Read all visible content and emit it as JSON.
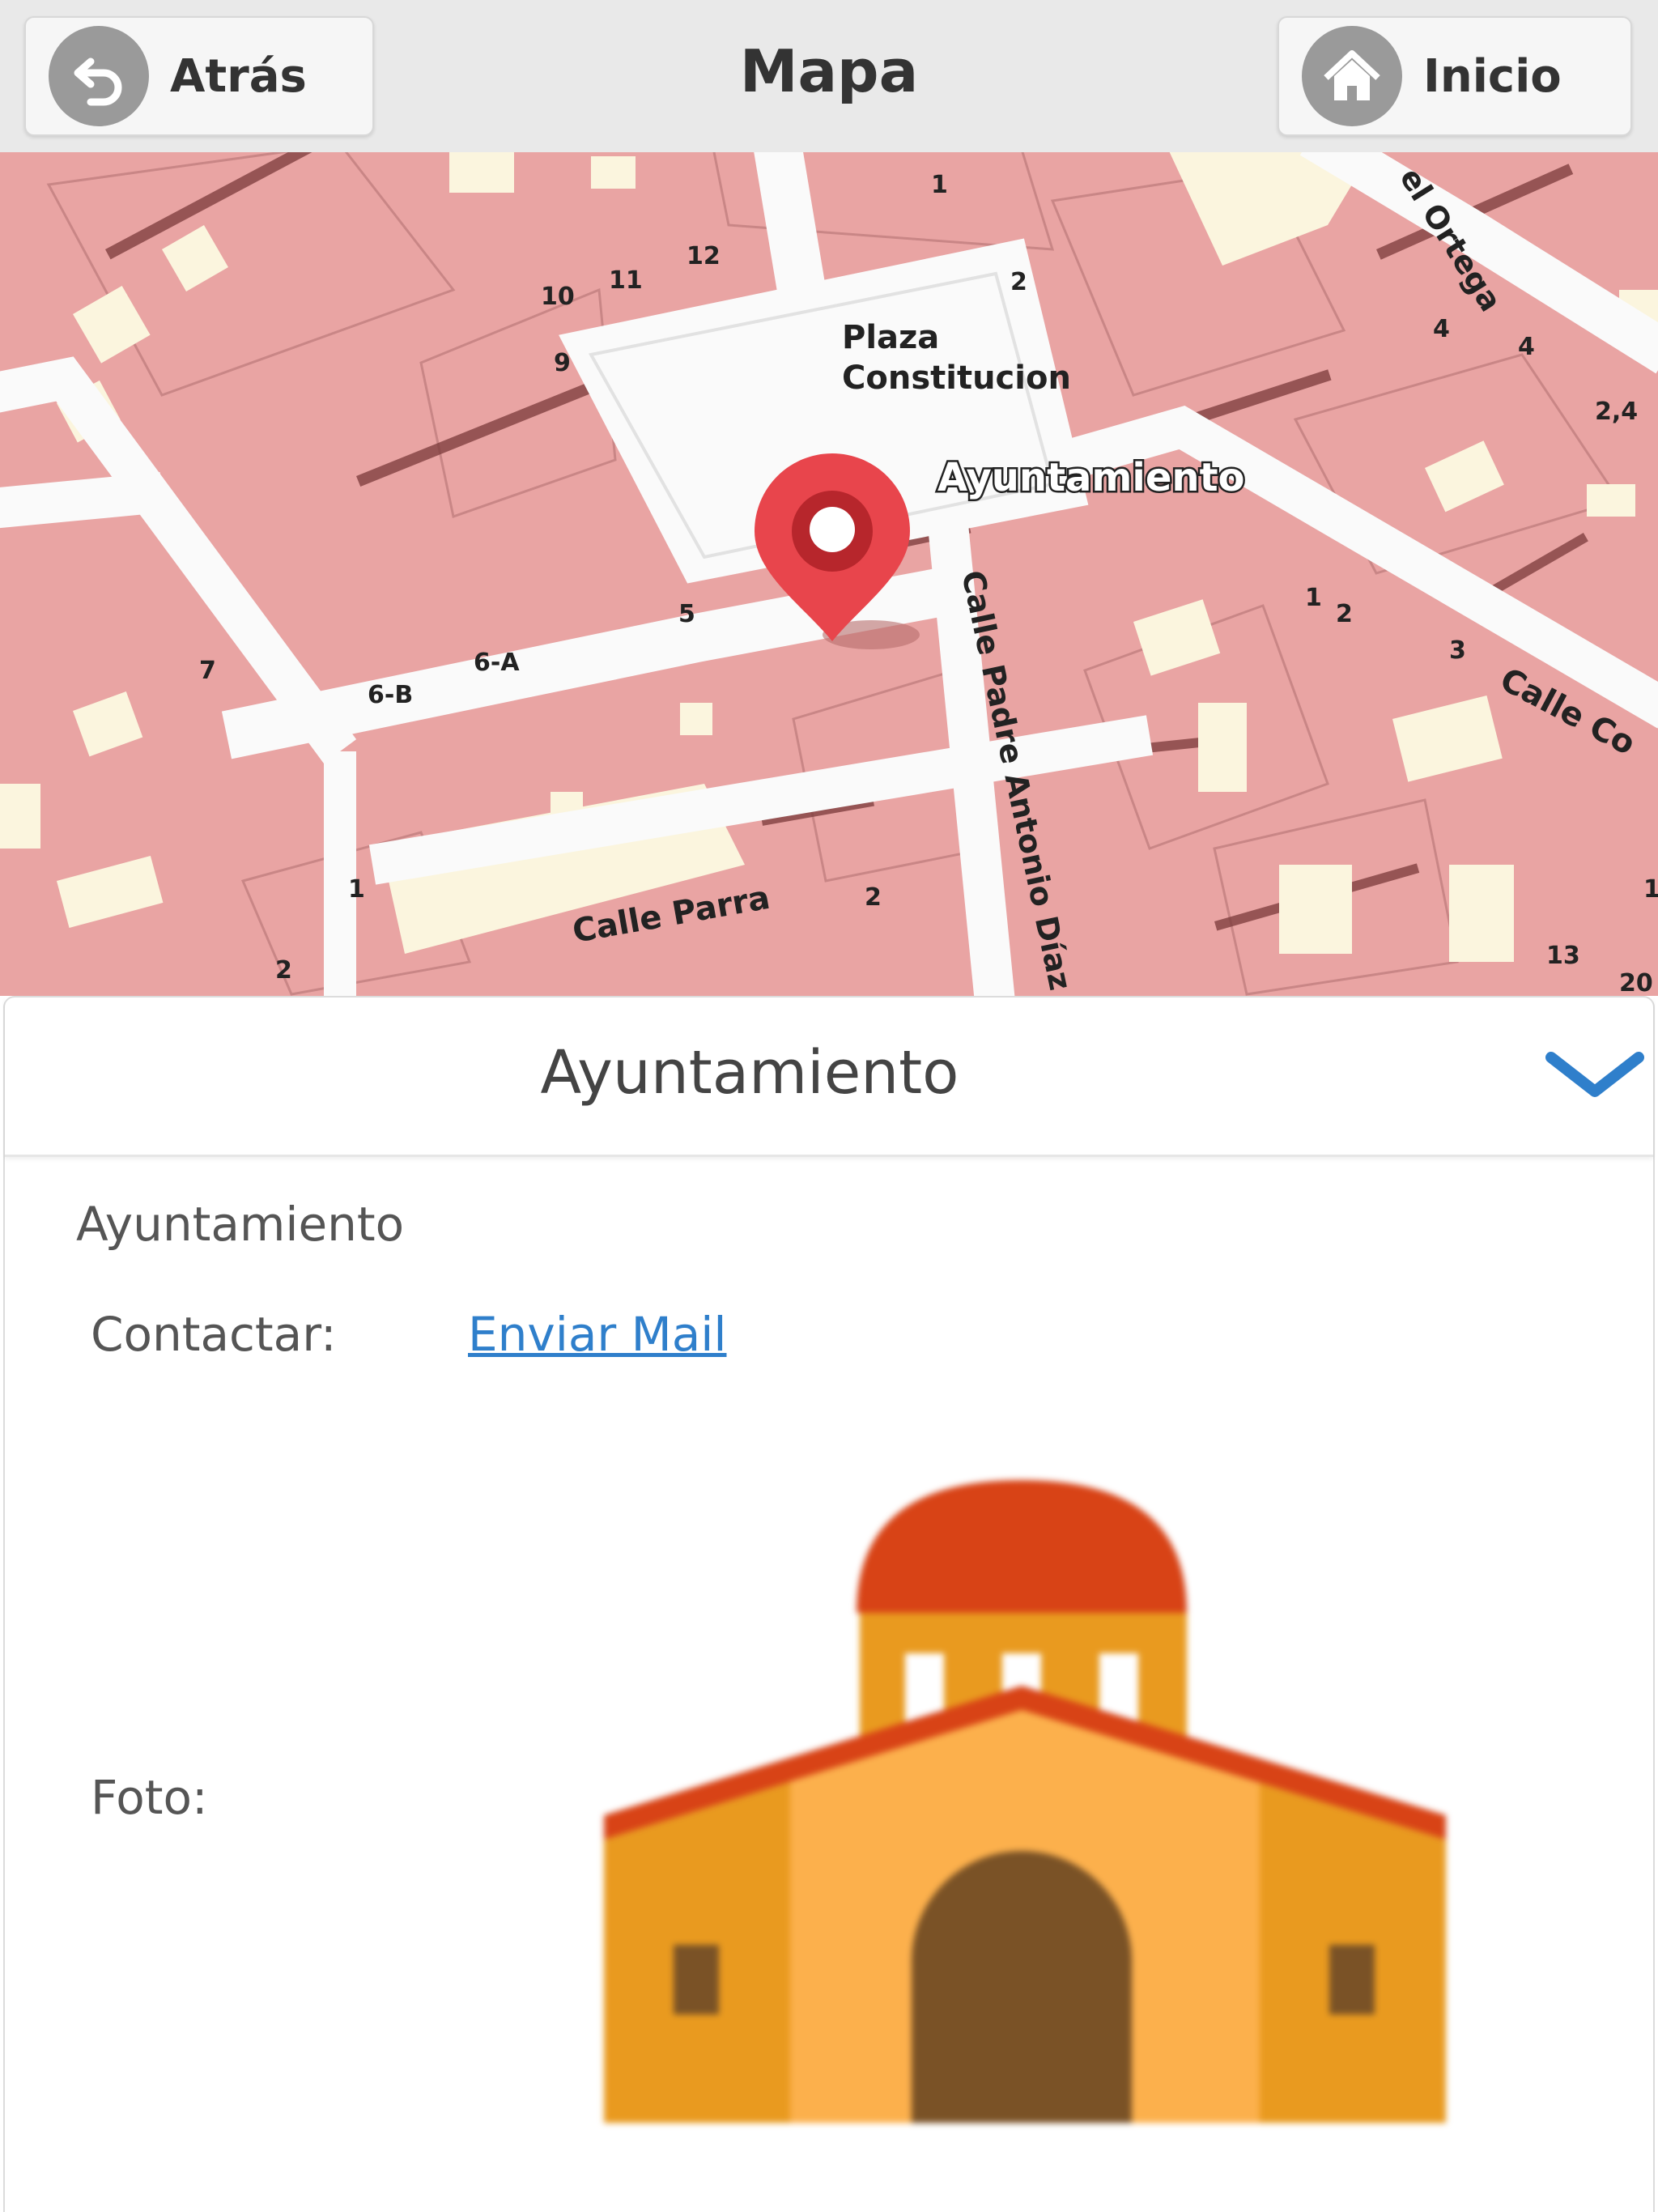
{
  "header": {
    "title": "Mapa",
    "back_label": "Atrás",
    "home_label": "Inicio"
  },
  "map": {
    "place_label": "Plaza Constitucion",
    "poi_label": "Ayuntamiento",
    "streets": [
      "el Ortega",
      "Calle Padre Antonio Díaz Ro",
      "Calle Parra",
      "Calle Co"
    ],
    "house_numbers": [
      "1",
      "2",
      "3",
      "4",
      "5",
      "6-A",
      "6-B",
      "7",
      "9",
      "10",
      "11",
      "12",
      "13",
      "20",
      "2,4"
    ],
    "colors": {
      "building": "#e9a4a3",
      "street": "#fafafa",
      "courtyard": "#fbf5de",
      "wall": "#7a3a3a",
      "marker": "#e8454c"
    }
  },
  "panel": {
    "title": "Ayuntamiento",
    "name": "Ayuntamiento",
    "contact_label": "Contactar:",
    "mail_link": "Enviar Mail",
    "photo_label": "Foto:",
    "photo_icon": "town-hall-icon",
    "accent": "#2f7fcb"
  }
}
